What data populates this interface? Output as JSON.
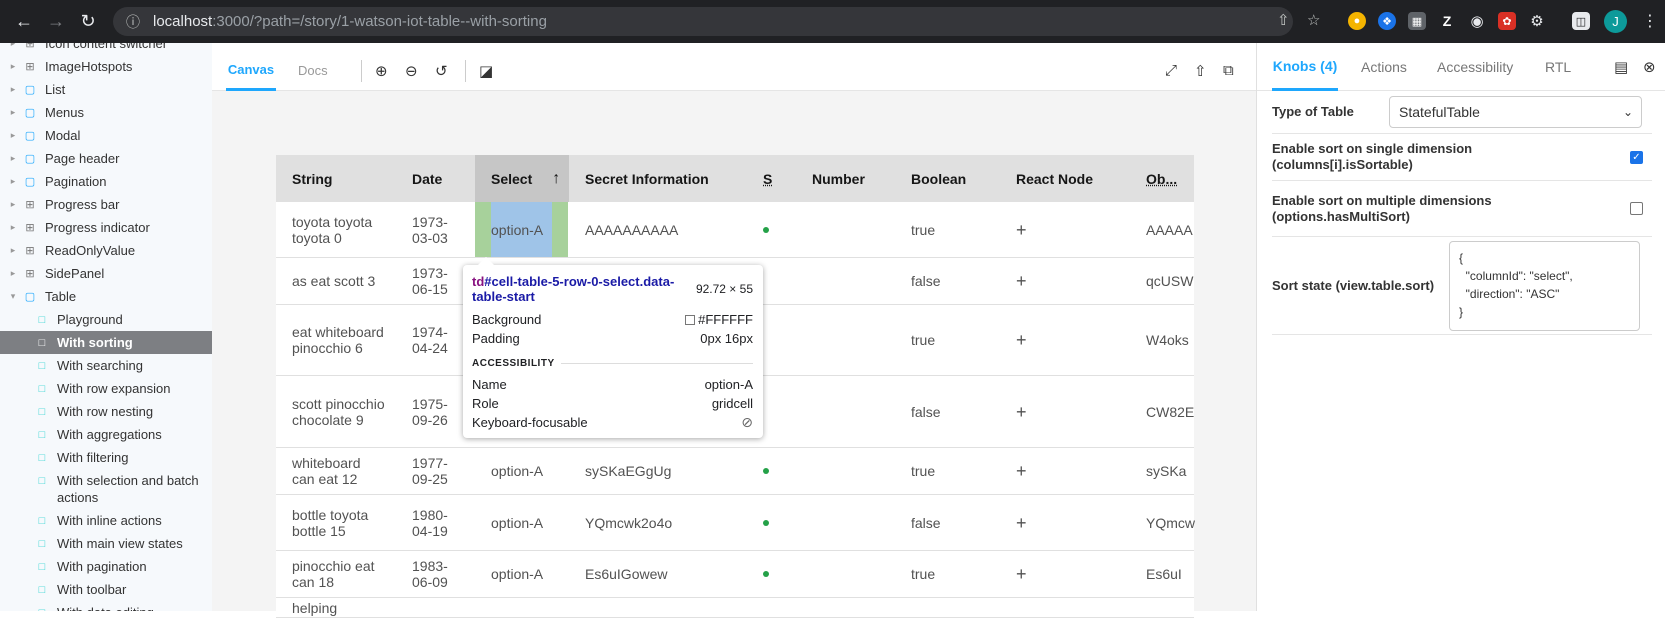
{
  "browser": {
    "url_host": "localhost",
    "url_rest": ":3000/?path=/story/1-watson-iot-table--with-sorting",
    "avatar_letter": "J"
  },
  "sidebar": {
    "items": [
      {
        "label": "Icon content switcher",
        "kind": "grp"
      },
      {
        "label": "ImageHotspots",
        "kind": "grp"
      },
      {
        "label": "List",
        "kind": "fold"
      },
      {
        "label": "Menus",
        "kind": "fold"
      },
      {
        "label": "Modal",
        "kind": "fold"
      },
      {
        "label": "Page header",
        "kind": "fold"
      },
      {
        "label": "Pagination",
        "kind": "fold"
      },
      {
        "label": "Progress bar",
        "kind": "grp"
      },
      {
        "label": "Progress indicator",
        "kind": "grp"
      },
      {
        "label": "ReadOnlyValue",
        "kind": "grp"
      },
      {
        "label": "SidePanel",
        "kind": "grp"
      },
      {
        "label": "Table",
        "kind": "fold"
      }
    ],
    "stories": [
      {
        "label": "Playground"
      },
      {
        "label": "With sorting",
        "selected": true
      },
      {
        "label": "With searching"
      },
      {
        "label": "With row expansion"
      },
      {
        "label": "With row nesting"
      },
      {
        "label": "With aggregations"
      },
      {
        "label": "With filtering"
      },
      {
        "label": "With selection and batch actions"
      },
      {
        "label": "With inline actions"
      },
      {
        "label": "With main view states"
      },
      {
        "label": "With pagination"
      },
      {
        "label": "With toolbar"
      },
      {
        "label": "With data editing"
      }
    ]
  },
  "toolbar": {
    "tab_canvas": "Canvas",
    "tab_docs": "Docs"
  },
  "table": {
    "columns": [
      "String",
      "Date",
      "Select",
      "Secret Information",
      "S",
      "Number",
      "Boolean",
      "React Node",
      "Ob..."
    ],
    "sort_indicator": "↑",
    "rows": [
      {
        "string": "toyota toyota toyota 0",
        "date": "1973-03-03",
        "select": "option-A",
        "secret": "AAAAAAAAAA",
        "boolean": "true",
        "object": "AAAAA"
      },
      {
        "string": "as eat scott 3",
        "date": "1973-06-15",
        "select": "",
        "secret": "",
        "boolean": "false",
        "object": "qcUSW"
      },
      {
        "string": "eat whiteboard pinocchio 6",
        "date": "1974-04-24",
        "select": "",
        "secret": "",
        "boolean": "true",
        "object": "W4oks"
      },
      {
        "string": "scott pinocchio chocolate 9",
        "date": "1975-09-26",
        "select": "",
        "secret": "",
        "boolean": "false",
        "object": "CW82E"
      },
      {
        "string": "whiteboard can eat 12",
        "date": "1977-09-25",
        "select": "option-A",
        "secret": "sySKaEGgUg",
        "boolean": "true",
        "object": "sySKa"
      },
      {
        "string": "bottle toyota bottle 15",
        "date": "1980-04-19",
        "select": "option-A",
        "secret": "YQmcwk2o4o",
        "boolean": "false",
        "object": "YQmcw"
      },
      {
        "string": "pinocchio eat can 18",
        "date": "1983-06-09",
        "select": "option-A",
        "secret": "Es6uIGowew",
        "boolean": "true",
        "object": "Es6uI"
      },
      {
        "string": "helping",
        "date": "",
        "select": "",
        "secret": "",
        "boolean": "",
        "object": ""
      }
    ]
  },
  "tooltip": {
    "tag": "td",
    "selector": "#cell-table-5-row-0-select.data-table-start",
    "size": "92.72 × 55",
    "background_label": "Background",
    "background_value": "#FFFFFF",
    "padding_label": "Padding",
    "padding_value": "0px 16px",
    "section": "ACCESSIBILITY",
    "name_label": "Name",
    "name_value": "option-A",
    "role_label": "Role",
    "role_value": "gridcell",
    "kb_label": "Keyboard-focusable"
  },
  "panel": {
    "tabs": [
      "Knobs (4)",
      "Actions",
      "Accessibility",
      "RTL"
    ],
    "knobs": {
      "type_label": "Type of Table",
      "type_value": "StatefulTable",
      "single_label": "Enable sort on single dimension (columns[i].isSortable)",
      "single_checked": true,
      "multi_label": "Enable sort on multiple dimensions (options.hasMultiSort)",
      "multi_checked": false,
      "state_label": "Sort state (view.table.sort)",
      "state_value": "{\n  \"columnId\": \"select\",\n  \"direction\": \"ASC\"\n}"
    }
  },
  "colors": {
    "accent": "#1ea7fd",
    "selected_story_bg": "#7d7f83",
    "dot": "#24a148"
  }
}
